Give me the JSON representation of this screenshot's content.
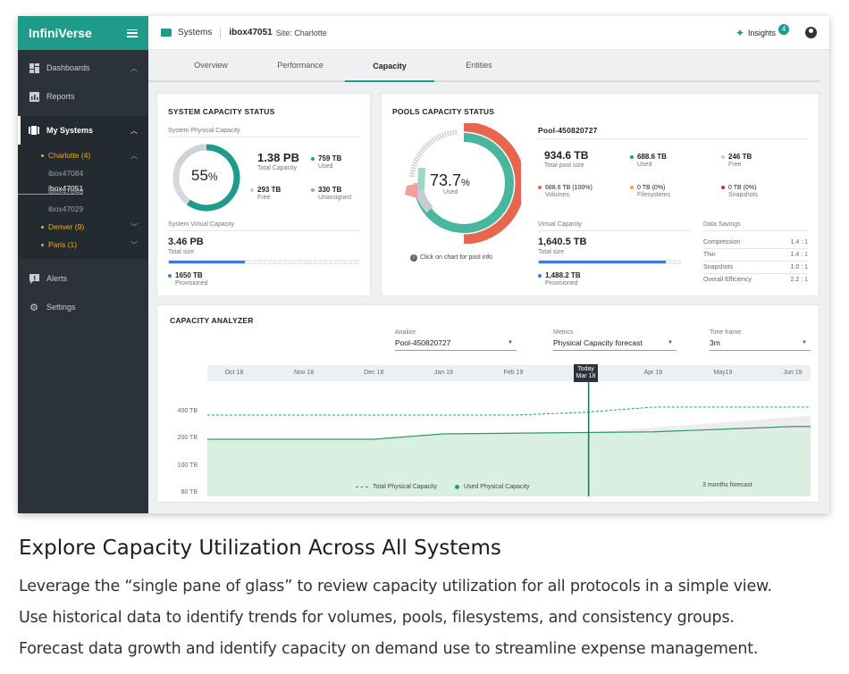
{
  "app": {
    "brand": "InfiniVerse"
  },
  "sidebar": {
    "items": [
      {
        "label": "Dashboards"
      },
      {
        "label": "Reports"
      },
      {
        "label": "My Systems"
      },
      {
        "label": "Alerts"
      },
      {
        "label": "Settings"
      }
    ],
    "sites": [
      {
        "label": "Charlotte (4)",
        "systems": [
          "ibox47084",
          "ibox47051",
          "ibox47040",
          "ibox47029"
        ]
      },
      {
        "label": "Denver (9)"
      },
      {
        "label": "Paris (1)"
      }
    ]
  },
  "header": {
    "section": "Systems",
    "system": "ibox47051",
    "site": "Site: Charlotte",
    "insights_label": "Insights",
    "insights_count": "4"
  },
  "tabs": [
    "Overview",
    "Performance",
    "Capacity",
    "Entities"
  ],
  "system_status": {
    "title": "SYSTEM CAPACITY STATUS",
    "physical_label": "System Physical Capacity",
    "percent": "55",
    "percent_sign": "%",
    "total": "1.38 PB",
    "total_label": "Total Capacity",
    "used": "759 TB",
    "used_label": "Used",
    "free": "293 TB",
    "free_label": "Free",
    "unassigned": "330 TB",
    "unassigned_label": "Unassigned",
    "virtual_label": "System Virtual Capacity",
    "virtual_total": "3.46 PB",
    "virtual_total_label": "Total size",
    "virtual_fraction": 0.4,
    "provisioned": "1650 TB",
    "provisioned_label": "Provisioned"
  },
  "pools_status": {
    "title": "POOLS CAPACITY STATUS",
    "pool": "Pool-450820727",
    "percent": "73.7",
    "percent_sign": "%",
    "used_center_label": "Used",
    "hint": "Click on chart for pool info",
    "total": "934.6 TB",
    "total_label": "Total pool size",
    "used": "688.6 TB",
    "used_label": "Used",
    "free": "246 TB",
    "free_label": "Free",
    "volumes": "688.6 TB (100%)",
    "volumes_label": "Volumes",
    "filesystems": "0 TB (0%)",
    "filesystems_label": "Filesystems",
    "snapshots": "0 TB (0%)",
    "snapshots_label": "Snapshots",
    "virtual_label": "Virtual Capacity",
    "virtual_total": "1,640.5 TB",
    "virtual_total_label": "Total size",
    "virtual_fraction": 0.9,
    "provisioned": "1,488.2 TB",
    "provisioned_label": "Provisioned",
    "savings_label": "Data Savings",
    "savings": [
      {
        "name": "Compression",
        "value": "1.4 : 1"
      },
      {
        "name": "Thin",
        "value": "1.4 : 1"
      },
      {
        "name": "Snapshots",
        "value": "1.0 : 1"
      },
      {
        "name": "Overall Efficiency",
        "value": "2.2 : 1"
      }
    ]
  },
  "analyzer": {
    "title": "CAPACITY ANALYZER",
    "analize_label": "Analize",
    "analize_value": "Pool-450820727",
    "metrics_label": "Metrics",
    "metrics_value": "Physical Capacity forecast",
    "timeframe_label": "Time frame",
    "timeframe_value": "3m",
    "today_label": "Today",
    "today_date": "Mar 18",
    "forecast_label": "3 months forecast"
  },
  "chart_data": {
    "type": "area",
    "x": [
      "Oct 18",
      "Nov 18",
      "Dec 18",
      "Jan 19",
      "Feb 19",
      "Mar 18",
      "Apr 19",
      "May19",
      "Jun 19"
    ],
    "y_ticks": [
      "400 TB",
      "200 TB",
      "100 TB",
      "80 TB"
    ],
    "series": [
      {
        "name": "Total Physical Capacity",
        "style": "dashed",
        "color": "#1f9b8b",
        "values": [
          380,
          380,
          380,
          380,
          380,
          400,
          430,
          430,
          430
        ]
      },
      {
        "name": "Used Physical Capacity",
        "style": "area",
        "color": "#2e9c5c",
        "values": [
          200,
          200,
          200,
          240,
          245,
          250,
          255,
          275,
          295
        ]
      }
    ]
  },
  "marketing": {
    "headline": "Explore Capacity Utilization Across All Systems",
    "lines": [
      "Leverage the “single pane of glass” to review capacity utilization for all protocols in a simple view.",
      "Use historical data to identify trends for volumes, pools, filesystems, and consistency groups.",
      "Forecast data growth and identify capacity on demand use to streamline expense management."
    ]
  }
}
